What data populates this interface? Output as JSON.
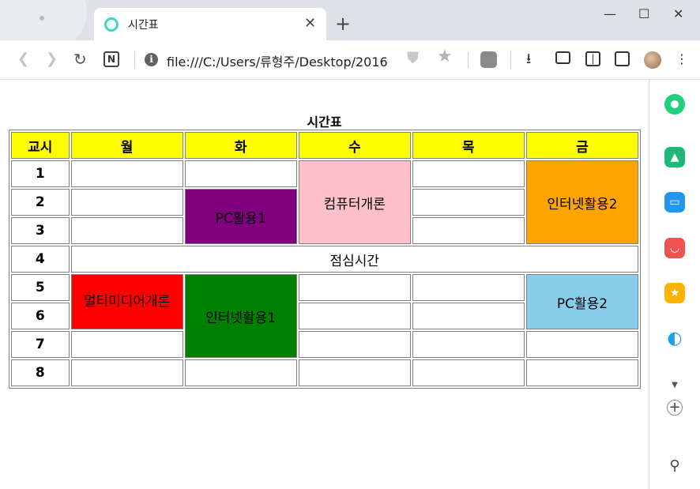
{
  "browser": {
    "tab_title": "시간표",
    "url": "file:///C:/Users/류형주/Desktop/2016"
  },
  "page": {
    "caption": "시간표",
    "headers": [
      "교시",
      "월",
      "화",
      "수",
      "목",
      "금"
    ],
    "periods": [
      "1",
      "2",
      "3",
      "4",
      "5",
      "6",
      "7",
      "8"
    ],
    "classes": {
      "computer_intro": "컴퓨터개론",
      "internet_2": "인터넷활용2",
      "pc_1": "PC활용1",
      "lunch": "점심시간",
      "multimedia_intro": "멀티미디어개론",
      "internet_1": "인터넷활용1",
      "pc_2": "PC활용2"
    }
  },
  "colors": {
    "header_bg": "#ffff00",
    "computer_intro": "#ffc0cb",
    "internet_2": "#ffa500",
    "pc_1": "#800080",
    "multimedia_intro": "#ff0000",
    "internet_1": "#008000",
    "pc_2": "#87ceeb",
    "tab_favicon": "#3fd6c2"
  },
  "icons": {
    "back": "arrow-left-icon",
    "forward": "arrow-right-icon",
    "reload": "reload-icon",
    "notion": "notion-icon",
    "info": "info-icon",
    "shield": "shield-icon",
    "star": "star-icon",
    "extension": "extension-icon",
    "download": "download-icon",
    "camera": "camera-icon",
    "reader": "reader-icon",
    "split_view": "split-view-icon",
    "menu": "menu-icon"
  }
}
